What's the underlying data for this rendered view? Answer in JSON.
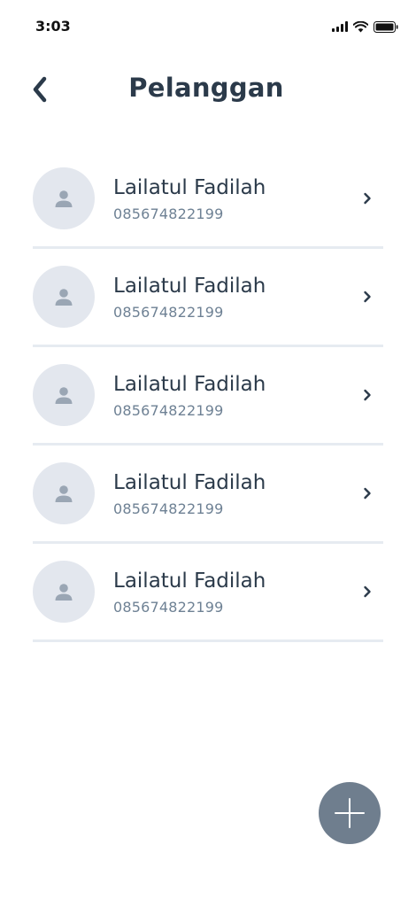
{
  "status_bar": {
    "time": "3:03"
  },
  "header": {
    "title": "Pelanggan",
    "back_icon": "chevron-left-icon"
  },
  "customers": [
    {
      "name": "Lailatul Fadilah",
      "phone": "085674822199"
    },
    {
      "name": "Lailatul Fadilah",
      "phone": "085674822199"
    },
    {
      "name": "Lailatul Fadilah",
      "phone": "085674822199"
    },
    {
      "name": "Lailatul Fadilah",
      "phone": "085674822199"
    },
    {
      "name": "Lailatul Fadilah",
      "phone": "085674822199"
    }
  ],
  "fab": {
    "icon": "plus-icon",
    "color": "#6f7e8e"
  },
  "colors": {
    "title_text": "#2b3a4a",
    "secondary_text": "#6e8194",
    "avatar_bg": "#e3e7ee",
    "avatar_icon": "#9aa6b4",
    "divider": "#e6ebf1"
  }
}
